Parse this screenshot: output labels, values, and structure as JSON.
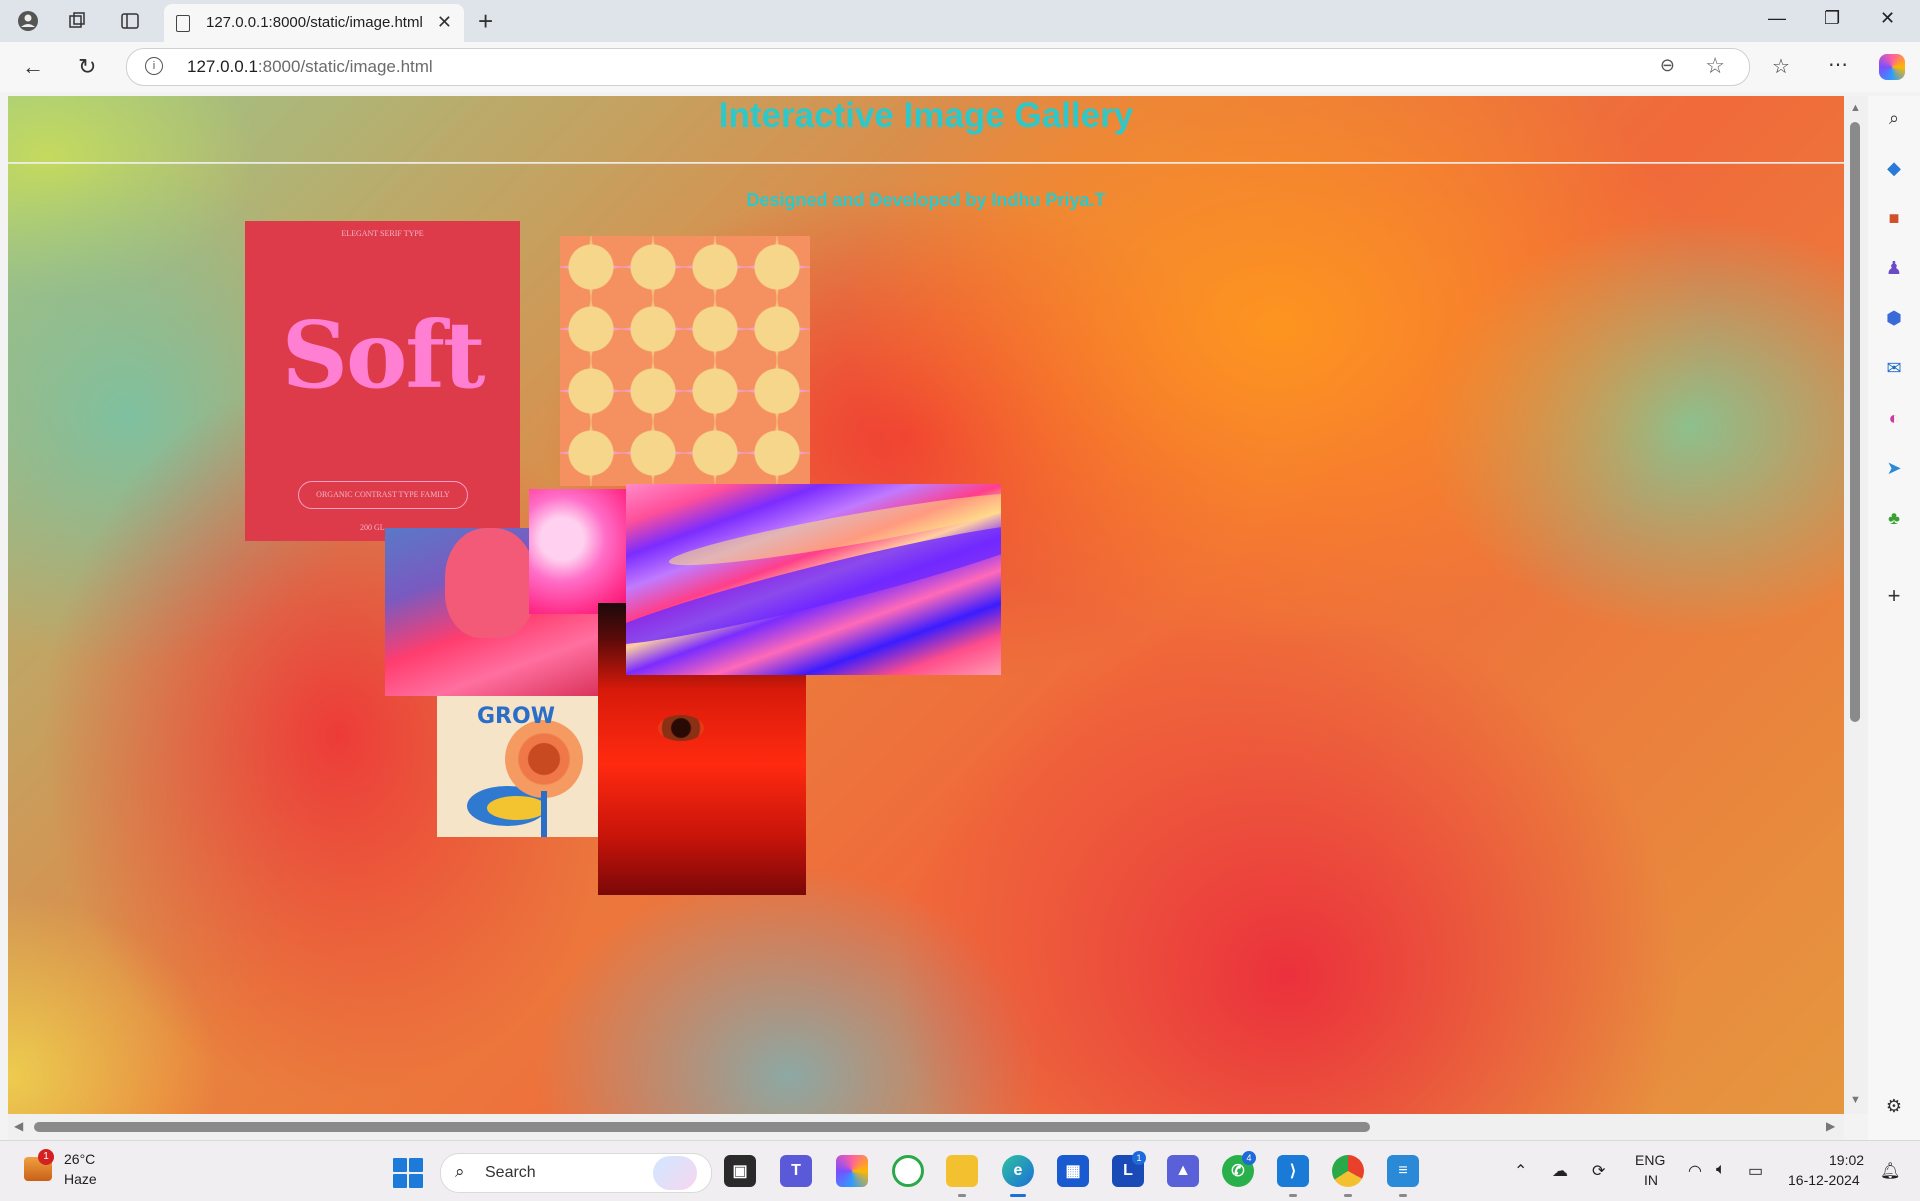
{
  "browser": {
    "tab_title": "127.0.0.1:8000/static/image.html",
    "url_host": "127.0.0.1",
    "url_path": ":8000/static/image.html"
  },
  "page": {
    "title": "Interactive Image Gallery",
    "subtitle": "Designed and Developed by Indhu Priya.T",
    "title_color": "#2ec8c8"
  },
  "gallery": {
    "soft_poster": {
      "top_text": "ELEGANT SERIF TYPE",
      "headline": "Soft",
      "pill_text": "ORGANIC CONTRAST TYPE FAMILY",
      "footer_text": "200 GL"
    },
    "grow_poster": {
      "headline": "GROW"
    },
    "images": [
      "soft-poster",
      "geometric-pattern",
      "pink-swirl",
      "portrait",
      "grow-poster",
      "eye-closeup",
      "holographic-wave"
    ]
  },
  "taskbar": {
    "weather_temp": "26°C",
    "weather_desc": "Haze",
    "weather_badge": "1",
    "search_label": "Search",
    "lang_line1": "ENG",
    "lang_line2": "IN",
    "time": "19:02",
    "date": "16-12-2024",
    "badges": {
      "l_app": "1",
      "whatsapp": "4"
    }
  },
  "colors": {
    "accent": "#2ec8c8",
    "taskbar_bg": "#f0eef0"
  }
}
